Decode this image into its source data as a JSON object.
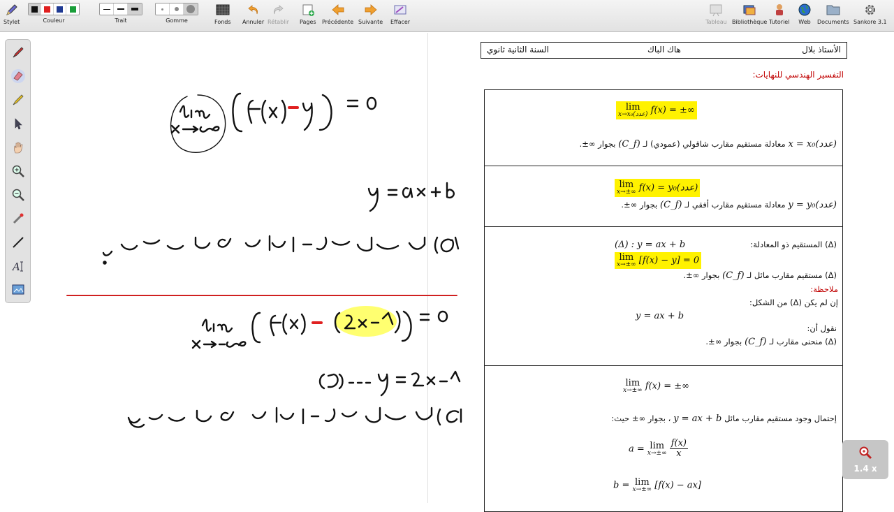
{
  "toolbar": {
    "pen": "Stylet",
    "colour": "Couleur",
    "stroke": "Trait",
    "eraser": "Gomme",
    "backgrounds": "Fonds",
    "undo": "Annuler",
    "redo": "Rétablir",
    "pages": "Pages",
    "previous": "Précédente",
    "next": "Suivante",
    "clear": "Effacer",
    "board": "Tableau",
    "library": "Bibliothèque",
    "tutorial": "Tutoriel",
    "web": "Web",
    "documents": "Documents",
    "app": "Sankore 3.1",
    "colors": [
      "#111111",
      "#e02020",
      "#1f3a93",
      "#1a9e3a"
    ]
  },
  "palette": {
    "tools": [
      "pen-tool",
      "eraser-tool",
      "marker-tool",
      "selector-tool",
      "hand-tool",
      "zoom-in-tool",
      "zoom-out-tool",
      "laser-tool",
      "line-tool",
      "text-tool",
      "capture-tool"
    ]
  },
  "doc": {
    "teacher": "الأستاذ بلال",
    "author": "هاك الباك",
    "level": "السنة الثانية ثانوي",
    "title": "التفسير الهندسي للنهايات:",
    "cell1": {
      "lim_word": "lim",
      "sub": "x→x₀(عدد)",
      "rhs": "f(x) = ±∞",
      "line_eq": "(عدد)x = x₀",
      "line_text": "معادلة مستقيم مقارب شاقولي (عمودي) لـ",
      "cf": "(C_f)",
      "tail": "بجوار ∞±."
    },
    "cell2": {
      "lim_word": "lim",
      "sub": "x→±∞",
      "rhs": "f(x) = y₀(عدد)",
      "line_eq": "(عدد)y = y₀",
      "line_text": "معادلة مستقيم مقارب أفقي لـ",
      "cf": "(C_f)",
      "tail": "بجوار ∞±."
    },
    "cell3": {
      "eq_label": "(Δ) المستقيم ذو المعادلة:",
      "eq": "(Δ) : y = ax + b",
      "lim_word": "lim",
      "sub": "x→±∞",
      "rhs": "[f(x) − y] = 0",
      "asym": "(Δ) مستقيم مقارب مائل لـ",
      "cf": "(C_f)",
      "asym_tail": "بجوار ∞±.",
      "note": "ملاحظة:",
      "if_not": "إن لم يكن (Δ) من الشكل:",
      "form": "y = ax + b",
      "we_say": "نقول أن:",
      "curve": "(Δ) منحنى مقارب لـ",
      "curve_tail": "بجوار ∞±."
    },
    "cell4": {
      "lim_word": "lim",
      "sub": "x→±∞",
      "rhs": "f(x) = ±∞",
      "possibility": "إحتمال وجود مستقيم مقارب مائل",
      "possibility_eq": "y = ax + b",
      "possibility_tail": "، بجوار ∞± حيث:",
      "a_lhs": "a =",
      "a_num": "f(x)",
      "a_den": "x",
      "b_lhs": "b =",
      "b_rhs": "[f(x) − ax]"
    }
  },
  "zoom": {
    "value": "1.4 x"
  }
}
